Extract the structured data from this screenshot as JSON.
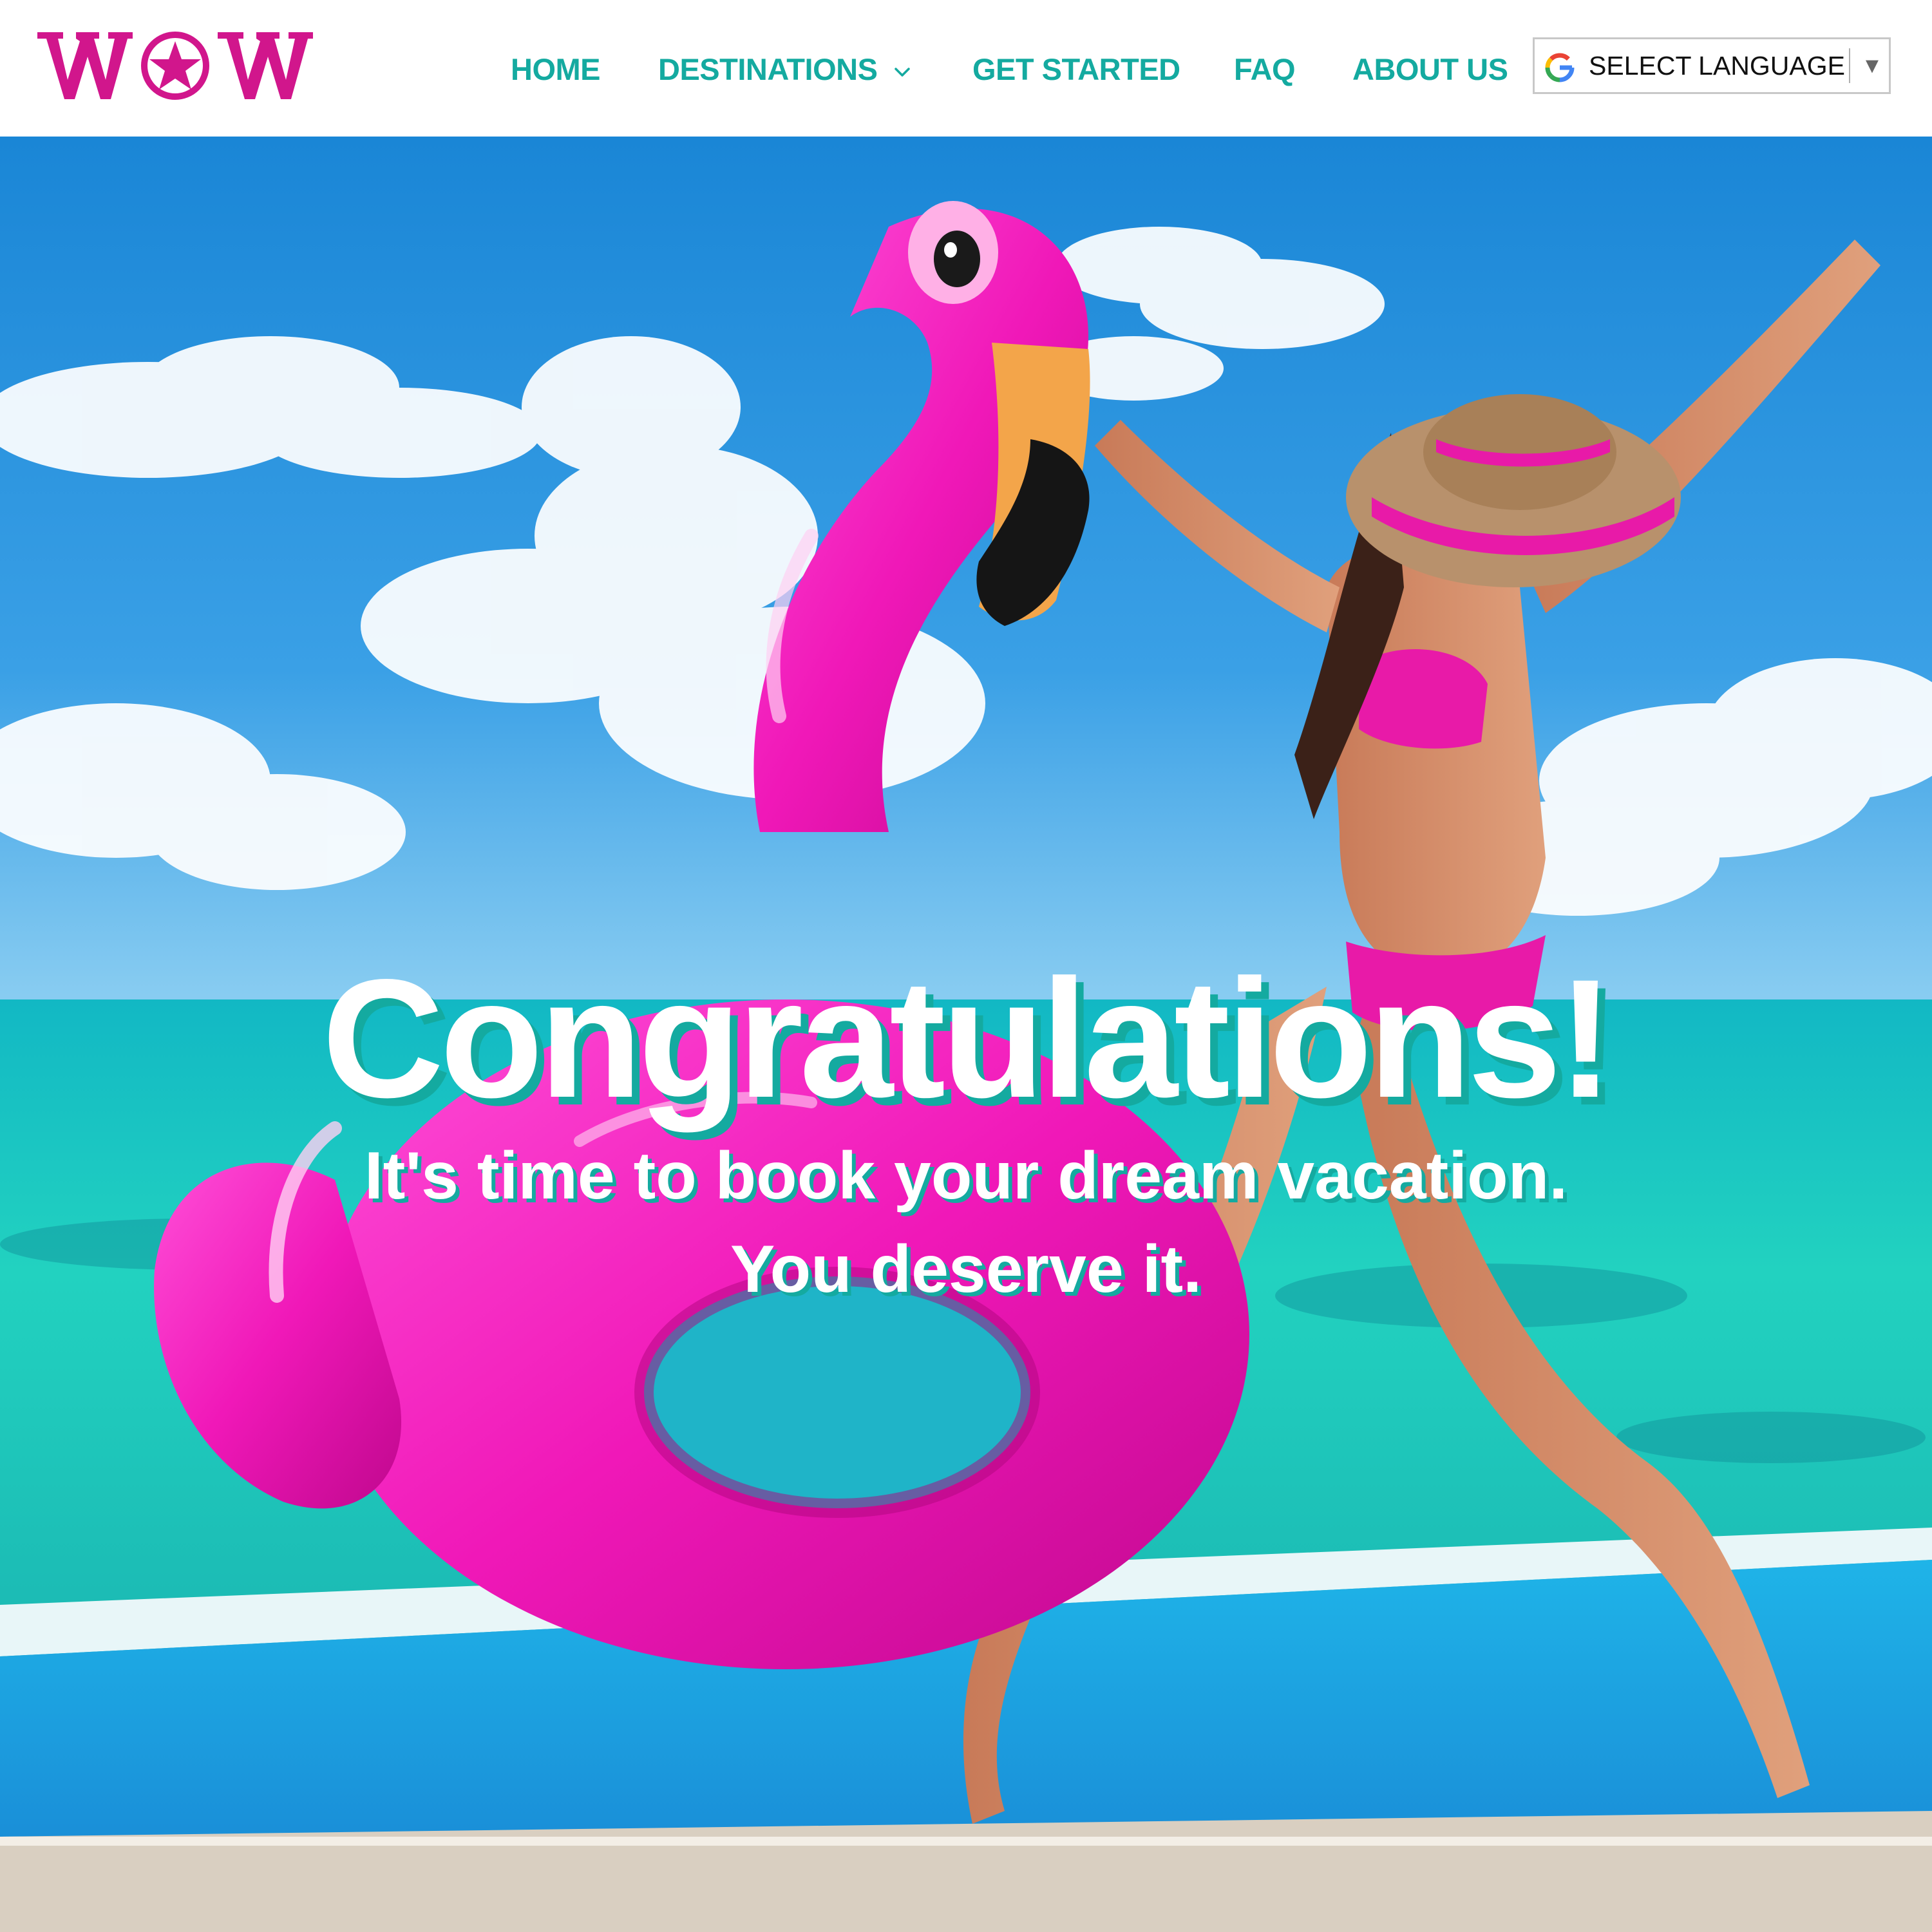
{
  "brand": {
    "logo_text": "WOW",
    "logo_color": "#d1168c",
    "accent_color": "#14aaa0"
  },
  "nav": {
    "items": [
      {
        "label": "HOME"
      },
      {
        "label": "DESTINATIONS",
        "has_dropdown": true,
        "icon": "chevron-down-icon"
      },
      {
        "label": "GET STARTED"
      },
      {
        "label": "FAQ"
      },
      {
        "label": "ABOUT US"
      }
    ]
  },
  "language_selector": {
    "label": "SELECT LANGUAGE",
    "icon": "google-g-icon",
    "arrow": "▼"
  },
  "hero": {
    "headline": "Congratulations!",
    "subline_1": "It's time to book your dream vacation.",
    "subline_2": "You deserve it."
  }
}
